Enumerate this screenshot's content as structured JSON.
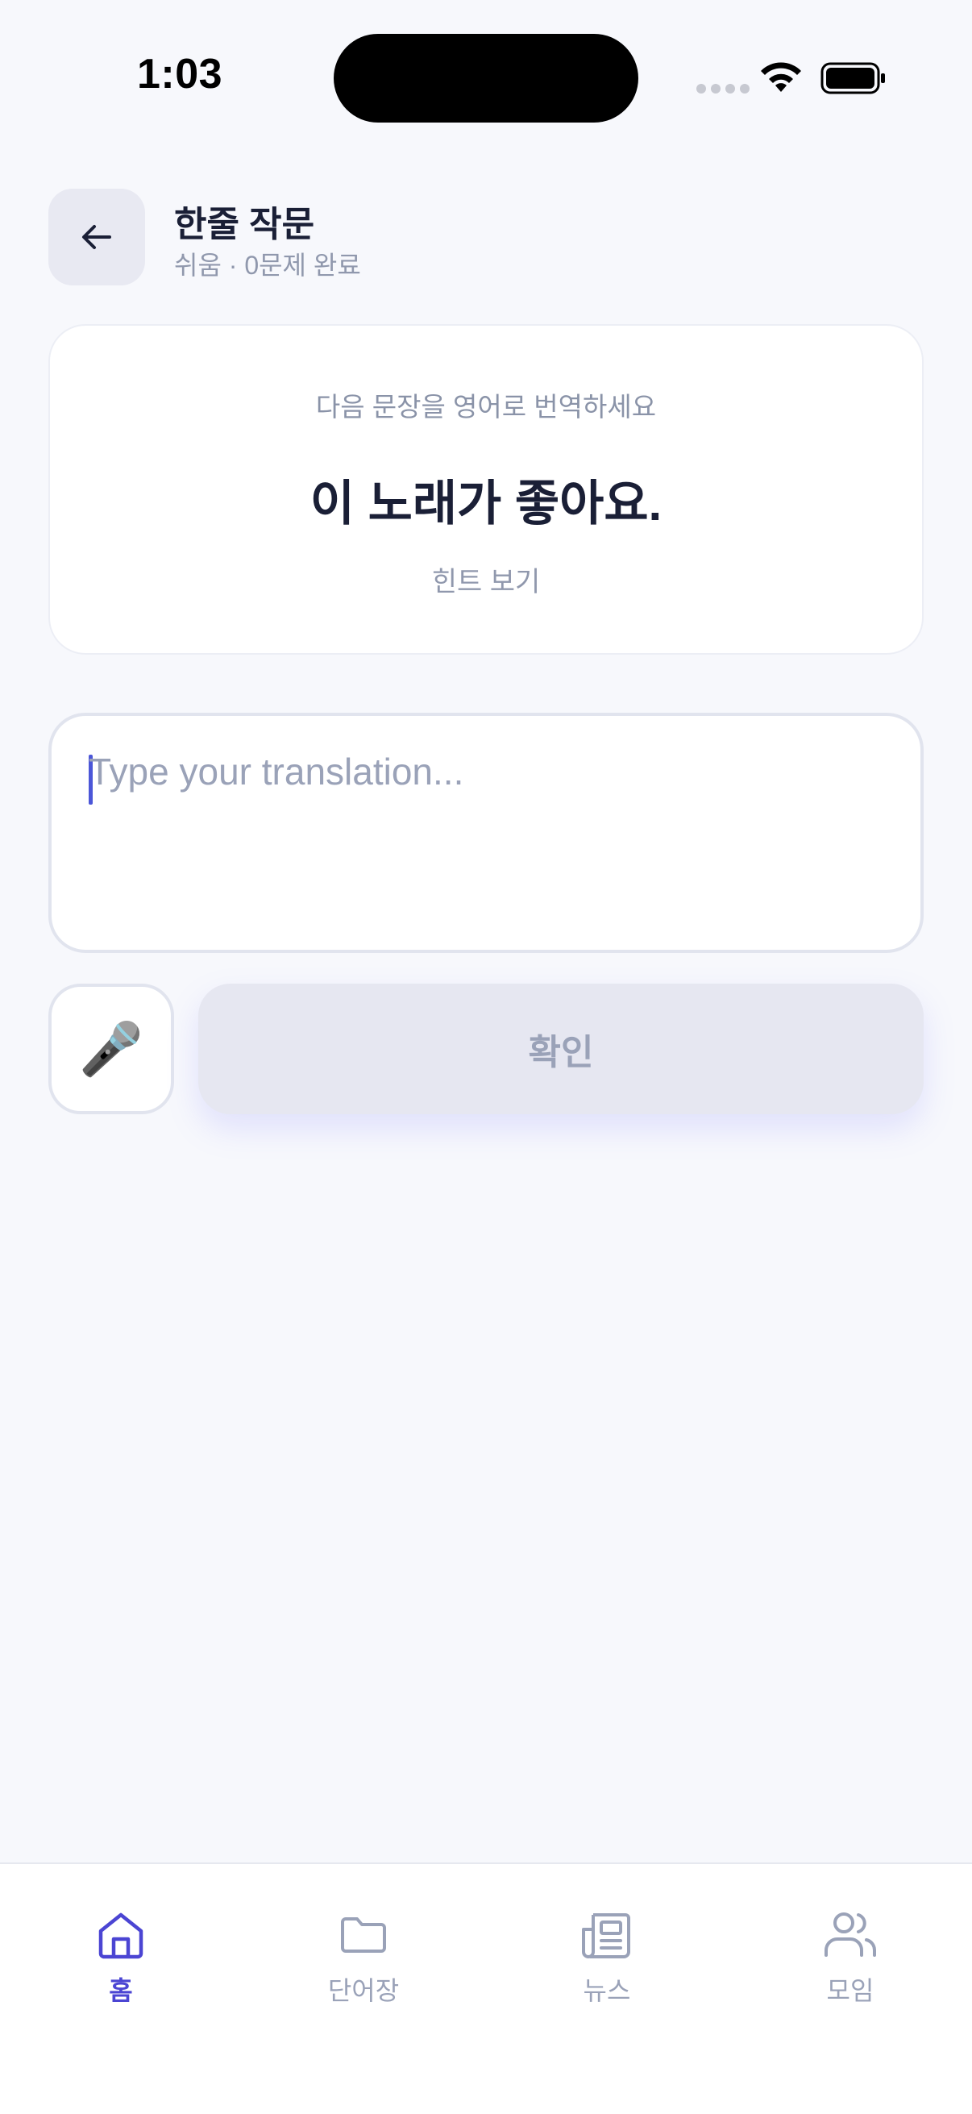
{
  "status_bar": {
    "time": "1:03"
  },
  "header": {
    "title": "한줄 작문",
    "subtitle": "쉬움 · 0문제 완료",
    "back_icon": "arrow-left-icon"
  },
  "prompt_card": {
    "instruction": "다음 문장을 영어로 번역하세요",
    "sentence": "이 노래가 좋아요.",
    "hint_label": "힌트 보기"
  },
  "translation_input": {
    "placeholder": "Type your translation...",
    "value": ""
  },
  "actions": {
    "mic_icon": "microphone-icon",
    "mic_glyph": "🎤",
    "confirm_label": "확인"
  },
  "bottom_nav": {
    "items": [
      {
        "label": "홈",
        "icon": "home-icon",
        "active": true
      },
      {
        "label": "단어장",
        "icon": "folder-icon",
        "active": false
      },
      {
        "label": "뉴스",
        "icon": "newspaper-icon",
        "active": false
      },
      {
        "label": "모임",
        "icon": "users-icon",
        "active": false
      }
    ]
  },
  "colors": {
    "accent": "#4b45d3",
    "background": "#f7f8fc",
    "muted_text": "#9aa2b8",
    "caret": "#4b56d8"
  }
}
